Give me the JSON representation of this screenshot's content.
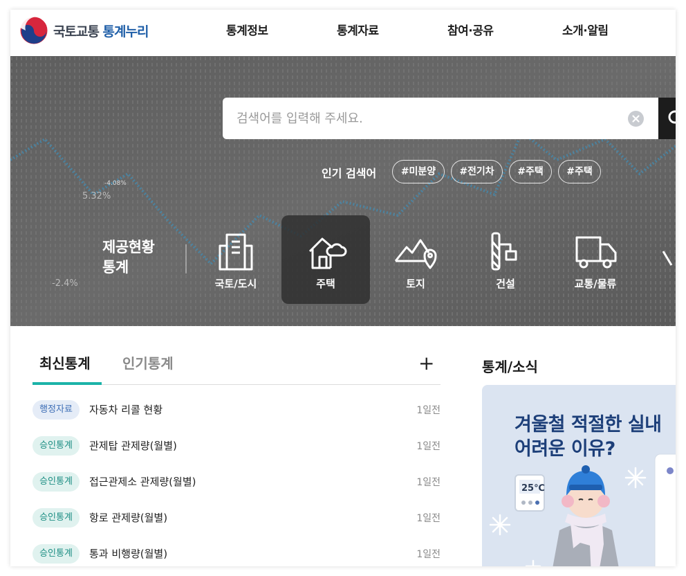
{
  "header": {
    "logo_text_a": "국토교통 ",
    "logo_text_b": "통계누리",
    "nav": [
      "통계정보",
      "통계자료",
      "참여·공유",
      "소개·알림"
    ]
  },
  "hero": {
    "search_placeholder": "검색어를 입력해 주세요.",
    "popular_label": "인기 검색어",
    "popular_tags": [
      "#미분양",
      "#전기차",
      "#주택",
      "#주택"
    ],
    "background_labels": [
      "-4.08%",
      "5.32%",
      "-2.4%"
    ],
    "category_title_line1": "제공현황",
    "category_title_line2": "통계",
    "categories": [
      "국토/도시",
      "주택",
      "토지",
      "건설",
      "교통/물류"
    ],
    "active_category": "주택"
  },
  "latest": {
    "tabs": [
      "최신통계",
      "인기통계"
    ],
    "active_tab": "최신통계",
    "more_label": "+",
    "rows": [
      {
        "badge": "행정자료",
        "badge_type": "admin",
        "title": "자동차 리콜 현황",
        "time": "1일전"
      },
      {
        "badge": "승인통계",
        "badge_type": "approved",
        "title": "관제탑 관제량(월별)",
        "time": "1일전"
      },
      {
        "badge": "승인통계",
        "badge_type": "approved",
        "title": "접근관제소 관제량(월별)",
        "time": "1일전"
      },
      {
        "badge": "승인통계",
        "badge_type": "approved",
        "title": "항로 관제량(월별)",
        "time": "1일전"
      },
      {
        "badge": "승인통계",
        "badge_type": "approved",
        "title": "통과 비행량(월별)",
        "time": "1일전"
      }
    ]
  },
  "news": {
    "section_title": "통계/소식",
    "card_line1": "겨울철 적절한 실내",
    "card_line2": "어려운 이유?",
    "thermostat": "25℃"
  },
  "colors": {
    "accent_teal": "#1bb3a8",
    "logo_blue": "#1f5fa8",
    "card_bg": "#dbe4f1",
    "card_title": "#1d3f79"
  },
  "icons": {
    "categories": [
      "building-icon",
      "house-cloud-icon",
      "land-pin-icon",
      "crane-icon",
      "truck-icon"
    ]
  }
}
